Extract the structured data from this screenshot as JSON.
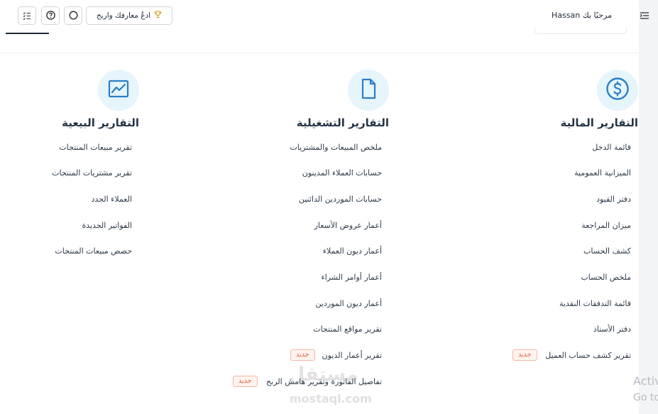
{
  "header": {
    "welcome": "مرحبًا بك Hassan",
    "invite_label": "ادعُ معارفك واربح",
    "icons": [
      "menu-icon",
      "circle-icon",
      "help-icon",
      "checklist-icon",
      "trophy-icon"
    ]
  },
  "columns": [
    {
      "id": "financial",
      "title": "التقارير المالية",
      "icon": "dollar-icon",
      "items": [
        {
          "label": "قائمة الدخل"
        },
        {
          "label": "الميزانية العمومية"
        },
        {
          "label": "دفتر القيود"
        },
        {
          "label": "ميزان المراجعة"
        },
        {
          "label": "كشف الحساب"
        },
        {
          "label": "ملخص الحساب"
        },
        {
          "label": "قائمة التدفقات النقدية"
        },
        {
          "label": "دفتر الأستاذ"
        },
        {
          "label": "تقرير كشف حساب العميل",
          "badge": "جديد"
        }
      ]
    },
    {
      "id": "operational",
      "title": "التقارير التشغيلية",
      "icon": "document-icon",
      "items": [
        {
          "label": "ملخص المبيعات والمشتريات"
        },
        {
          "label": "حسابات العملاء المدينون"
        },
        {
          "label": "حسابات الموردين الدائنين"
        },
        {
          "label": "أعمار عروض الأسعار"
        },
        {
          "label": "أعمار ديون العملاء"
        },
        {
          "label": "أعمار أوامر الشراء"
        },
        {
          "label": "أعمار ديون الموردين"
        },
        {
          "label": "تقرير مواقع المنتجات"
        },
        {
          "label": "تقرير أعمار الديون",
          "badge": "جديد"
        },
        {
          "label": "تفاصيل الفاتورة وتقرير هامش الربح",
          "badge": "جديد"
        }
      ]
    },
    {
      "id": "sales",
      "title": "التقارير البيعية",
      "icon": "trend-chart-icon",
      "items": [
        {
          "label": "تقرير مبيعات المنتجات"
        },
        {
          "label": "تقرير مشتريات المنتجات"
        },
        {
          "label": "العملاء الجدد"
        },
        {
          "label": "الفواتير الجديدة"
        },
        {
          "label": "حصص مبيعات المنتجات"
        }
      ]
    }
  ],
  "watermark": {
    "arabic": "مستقل",
    "latin": "mostaql.com"
  },
  "os_overlay": {
    "line1": "Activ",
    "line2": "Go to"
  },
  "colors": {
    "accent": "#2a7fc4",
    "icon_bg": "#e6f4fc",
    "badge_text": "#e0613a"
  }
}
